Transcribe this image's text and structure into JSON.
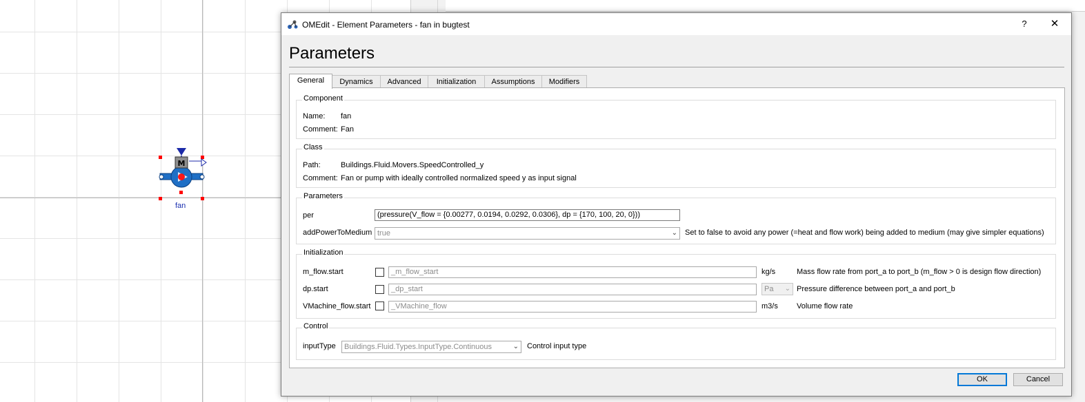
{
  "diagram": {
    "component_label": "fan",
    "motor_letter": "M"
  },
  "dialog": {
    "title": "OMEdit - Element Parameters - fan in bugtest",
    "help_symbol": "?",
    "close_symbol": "✕",
    "heading": "Parameters",
    "tabs": [
      {
        "label": "General",
        "active": true
      },
      {
        "label": "Dynamics",
        "active": false
      },
      {
        "label": "Advanced",
        "active": false
      },
      {
        "label": "Initialization",
        "active": false
      },
      {
        "label": "Assumptions",
        "active": false
      },
      {
        "label": "Modifiers",
        "active": false
      }
    ],
    "component_group": {
      "title": "Component",
      "name_label": "Name:",
      "name_value": "fan",
      "comment_label": "Comment:",
      "comment_value": "Fan"
    },
    "class_group": {
      "title": "Class",
      "path_label": "Path:",
      "path_value": "Buildings.Fluid.Movers.SpeedControlled_y",
      "comment_label": "Comment:",
      "comment_value": "Fan or pump with ideally controlled normalized speed y as input signal"
    },
    "parameters_group": {
      "title": "Parameters",
      "per_label": "per",
      "per_value": "(pressure(V_flow = {0.00277, 0.0194, 0.0292, 0.0306}, dp = {170, 100, 20, 0}))",
      "addpower_label": "addPowerToMedium",
      "addpower_value": "true",
      "addpower_desc": "Set to false to avoid any power (=heat and flow work) being added to medium (may give simpler equations)"
    },
    "initialization_group": {
      "title": "Initialization",
      "rows": [
        {
          "label": "m_flow.start",
          "placeholder": "_m_flow_start",
          "unit": "kg/s",
          "desc": "Mass flow rate from port_a to port_b (m_flow > 0 is design flow direction)"
        },
        {
          "label": "dp.start",
          "placeholder": "_dp_start",
          "unit": "Pa",
          "desc": "Pressure difference between port_a and port_b"
        },
        {
          "label": "VMachine_flow.start",
          "placeholder": "_VMachine_flow",
          "unit": "m3/s",
          "desc": "Volume flow rate"
        }
      ]
    },
    "control_group": {
      "title": "Control",
      "inputtype_label": "inputType",
      "inputtype_value": "Buildings.Fluid.Types.InputType.Continuous",
      "inputtype_desc": "Control input type"
    },
    "ok_label": "OK",
    "cancel_label": "Cancel"
  },
  "colors": {
    "accent": "#0078d7",
    "selection_handle": "#ff0000",
    "component_blue": "#1f6fc5",
    "label_blue": "#1a2fb0"
  }
}
